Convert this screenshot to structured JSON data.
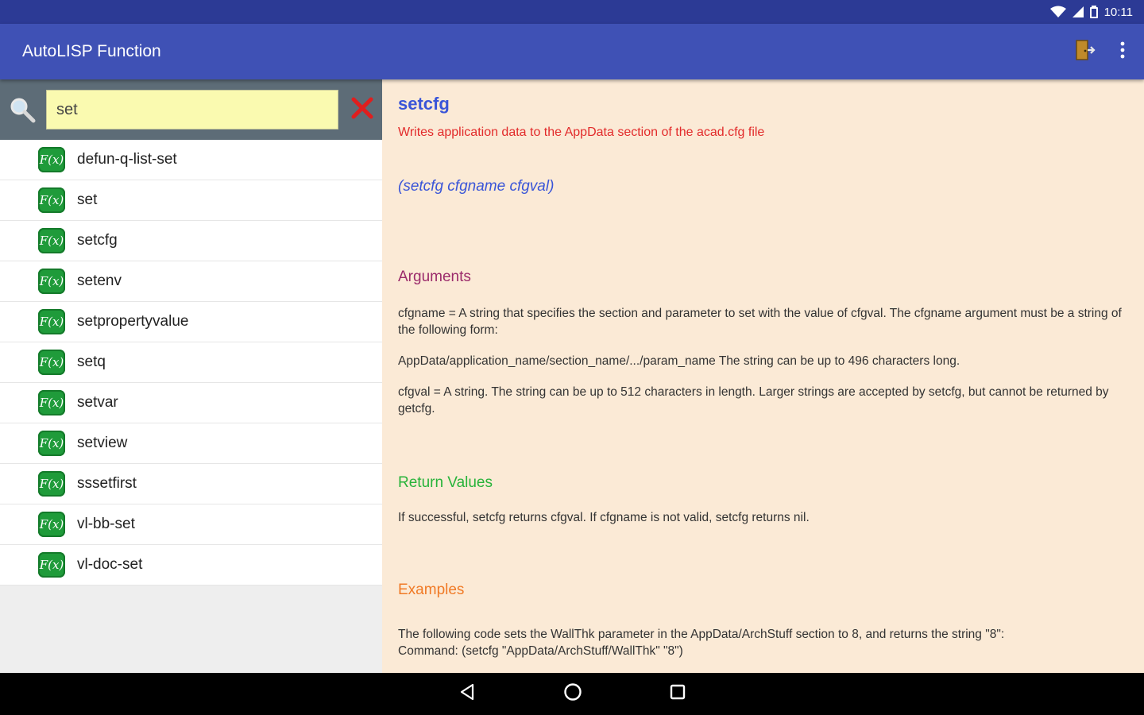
{
  "status": {
    "time": "10:11"
  },
  "app": {
    "title": "AutoLISP Function"
  },
  "colors": {
    "status_bar": "#2c3a95",
    "app_bar": "#3f51b5",
    "search_bar": "#5d6c77",
    "search_field": "#fafab0",
    "detail_bg": "#fbead6",
    "title_blue": "#3a55d8",
    "desc_red": "#e22b2b",
    "args_purple": "#9b2b6b",
    "return_green": "#27b33a",
    "examples_orange": "#f07a26",
    "fx_green": "#1f9b3a"
  },
  "search": {
    "value": "set"
  },
  "list": {
    "icon_label": "F(x)",
    "items": [
      "defun-q-list-set",
      "set",
      "setcfg",
      "setenv",
      "setpropertyvalue",
      "setq",
      "setvar",
      "setview",
      "sssetfirst",
      "vl-bb-set",
      "vl-doc-set"
    ]
  },
  "detail": {
    "title": "setcfg",
    "description": "Writes application data to the AppData section of the acad.cfg file",
    "syntax": "(setcfg cfgname cfgval)",
    "arguments_heading": "Arguments",
    "arguments": [
      "cfgname = A string that specifies the section and parameter to set with the value of cfgval. The cfgname argument must be a string of the following form:",
      "AppData/application_name/section_name/.../param_name The string can be up to 496 characters long.",
      "cfgval = A string. The string can be up to 512 characters in length. Larger strings are accepted by setcfg, but cannot be returned by getcfg."
    ],
    "return_heading": "Return Values",
    "return_text": "If successful, setcfg returns cfgval. If cfgname is not valid, setcfg returns nil.",
    "examples_heading": "Examples",
    "examples_text": "The following code sets the WallThk parameter in the AppData/ArchStuff section to 8, and returns the string \"8\":",
    "examples_code": "Command: (setcfg \"AppData/ArchStuff/WallThk\" \"8\")"
  }
}
